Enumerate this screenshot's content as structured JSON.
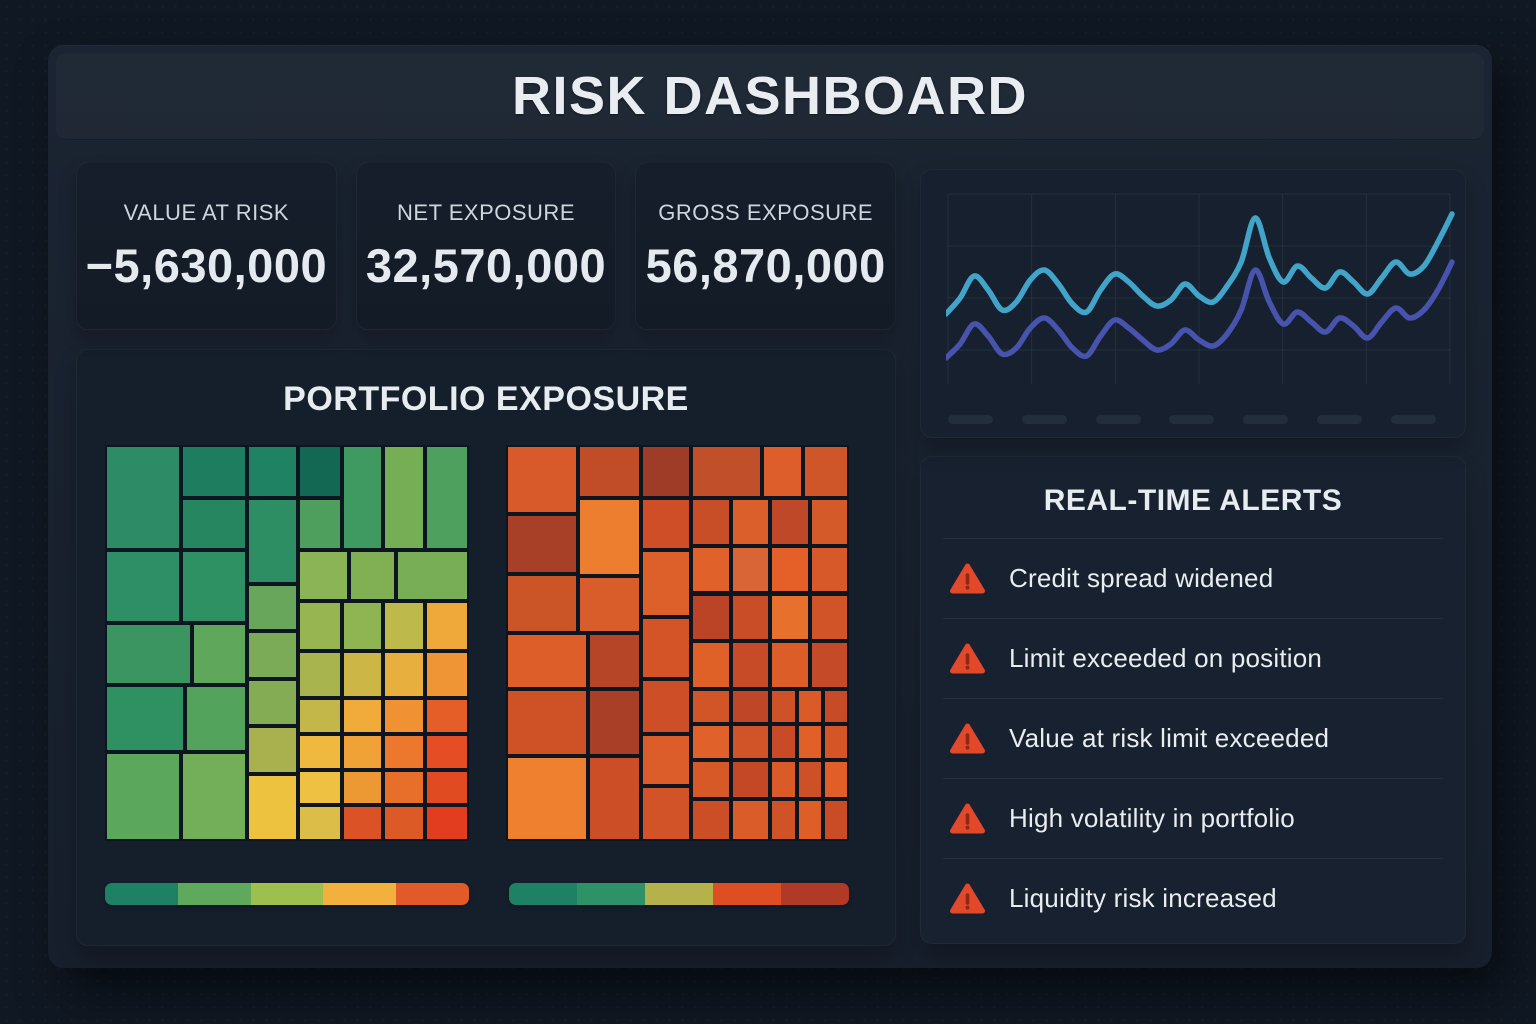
{
  "title": "RISK DASHBOARD",
  "kpis": [
    {
      "label": "VALUE AT RISK",
      "value": "−5,630,000"
    },
    {
      "label": "NET EXPOSURE",
      "value": "32,570,000"
    },
    {
      "label": "GROSS EXPOSURE",
      "value": "56,870,000"
    }
  ],
  "portfolio": {
    "title": "PORTFOLIO EXPOSURE",
    "treemaps": [
      {
        "name": "exposure-treemap-green",
        "tiles": [
          [
            0,
            0,
            21,
            26.5,
            "#2D8C66"
          ],
          [
            21,
            0,
            18,
            13.5,
            "#1E7C5F"
          ],
          [
            39,
            0,
            14,
            13.5,
            "#1F8263"
          ],
          [
            53,
            0,
            12,
            13.5,
            "#136853"
          ],
          [
            65,
            0,
            11.5,
            26.5,
            "#3E9A60"
          ],
          [
            76.5,
            0,
            11.5,
            26.5,
            "#76AE56"
          ],
          [
            88,
            0,
            12,
            26.5,
            "#4EA05F"
          ],
          [
            21,
            13.5,
            18,
            13,
            "#26865F"
          ],
          [
            39,
            13.5,
            14,
            21.5,
            "#2D8D63"
          ],
          [
            53,
            13.5,
            12,
            13,
            "#4E9E5E"
          ],
          [
            0,
            26.5,
            21,
            18.5,
            "#2E8F66"
          ],
          [
            21,
            26.5,
            18,
            18.5,
            "#2E9163"
          ],
          [
            53,
            26.5,
            14,
            13,
            "#8AB455"
          ],
          [
            67,
            26.5,
            13,
            13,
            "#81B054"
          ],
          [
            80,
            26.5,
            20,
            13,
            "#78AE55"
          ],
          [
            39,
            35,
            14,
            12,
            "#68A75B"
          ],
          [
            53,
            39.5,
            12,
            12.5,
            "#97B551"
          ],
          [
            65,
            39.5,
            11.5,
            12.5,
            "#8FB553"
          ],
          [
            76.5,
            39.5,
            11.5,
            12.5,
            "#BDBA4B"
          ],
          [
            88,
            39.5,
            12,
            12.5,
            "#EFA93A"
          ],
          [
            0,
            45,
            24,
            15.5,
            "#3A9560"
          ],
          [
            24,
            45,
            15,
            15.5,
            "#5FA85B"
          ],
          [
            39,
            47,
            14,
            12,
            "#7CAB57"
          ],
          [
            53,
            52,
            12,
            12,
            "#A8B44E"
          ],
          [
            65,
            52,
            11.5,
            12,
            "#CBB646"
          ],
          [
            76.5,
            52,
            11.5,
            12,
            "#E7AF3E"
          ],
          [
            88,
            52,
            12,
            12,
            "#F09536"
          ],
          [
            0,
            60.5,
            22,
            17,
            "#2F9161"
          ],
          [
            22,
            60.5,
            17,
            17,
            "#53A35D"
          ],
          [
            39,
            59,
            14,
            12,
            "#83AC55"
          ],
          [
            53,
            64,
            12,
            9,
            "#C3B74A"
          ],
          [
            65,
            64,
            11.5,
            9,
            "#F0AB3B"
          ],
          [
            76.5,
            64,
            11.5,
            9,
            "#F09234"
          ],
          [
            88,
            64,
            12,
            9,
            "#E55E28"
          ],
          [
            39,
            71,
            14,
            12,
            "#A9B14E"
          ],
          [
            53,
            73,
            12,
            9,
            "#EFB83E"
          ],
          [
            65,
            73,
            11.5,
            9,
            "#F0A237"
          ],
          [
            76.5,
            73,
            11.5,
            9,
            "#EB782C"
          ],
          [
            88,
            73,
            12,
            9,
            "#E54D24"
          ],
          [
            0,
            77.5,
            21,
            22.5,
            "#5BA85C"
          ],
          [
            21,
            77.5,
            18,
            22.5,
            "#72AF58"
          ],
          [
            39,
            83,
            14,
            17,
            "#EDC23F"
          ],
          [
            53,
            82,
            12,
            9,
            "#EEC143"
          ],
          [
            65,
            82,
            11.5,
            9,
            "#ED9933"
          ],
          [
            76.5,
            82,
            11.5,
            9,
            "#E76F2A"
          ],
          [
            88,
            82,
            12,
            9,
            "#E04B22"
          ],
          [
            53,
            91,
            12,
            9,
            "#DCBD47"
          ],
          [
            65,
            91,
            11.5,
            9,
            "#DA5226"
          ],
          [
            76.5,
            91,
            11.5,
            9,
            "#DC5A26"
          ],
          [
            88,
            91,
            12,
            9,
            "#E23D1F"
          ]
        ]
      },
      {
        "name": "exposure-treemap-orange",
        "tiles": [
          [
            0,
            0,
            21,
            17.5,
            "#D85A2A"
          ],
          [
            21,
            0,
            18.5,
            13.5,
            "#C14C28"
          ],
          [
            39.5,
            0,
            14.5,
            13.5,
            "#9E3C28"
          ],
          [
            54,
            0,
            20.5,
            13.5,
            "#C1502A"
          ],
          [
            74.5,
            0,
            12,
            13.5,
            "#DD5E2B"
          ],
          [
            86.5,
            0,
            13.5,
            13.5,
            "#CE5629"
          ],
          [
            0,
            17.5,
            21,
            15,
            "#A84028"
          ],
          [
            21,
            13.5,
            18.5,
            19.5,
            "#EE7E2F"
          ],
          [
            39.5,
            13.5,
            14.5,
            13,
            "#D04E27"
          ],
          [
            54,
            13.5,
            11.5,
            12,
            "#C84E28"
          ],
          [
            65.5,
            13.5,
            11.5,
            12,
            "#DB5F2A"
          ],
          [
            77,
            13.5,
            11.5,
            12,
            "#BE4827"
          ],
          [
            88.5,
            13.5,
            11.5,
            12,
            "#D55A29"
          ],
          [
            0,
            32.5,
            21,
            15,
            "#CC5528"
          ],
          [
            21,
            33,
            18.5,
            14.5,
            "#D85D2A"
          ],
          [
            39.5,
            26.5,
            14.5,
            17,
            "#DD5F29"
          ],
          [
            54,
            25.5,
            11.5,
            12,
            "#E06129"
          ],
          [
            65.5,
            25.5,
            11.5,
            12,
            "#D96536"
          ],
          [
            77,
            25.5,
            11.5,
            12,
            "#E55F28"
          ],
          [
            88.5,
            25.5,
            11.5,
            12,
            "#D75829"
          ],
          [
            54,
            37.5,
            11.5,
            12,
            "#BC4426"
          ],
          [
            65.5,
            37.5,
            11.5,
            12,
            "#C94E27"
          ],
          [
            77,
            37.5,
            11.5,
            12,
            "#E8702D"
          ],
          [
            88.5,
            37.5,
            11.5,
            12,
            "#D05428"
          ],
          [
            0,
            47.5,
            24,
            14,
            "#DE5E2A"
          ],
          [
            24,
            47.5,
            15.5,
            14,
            "#B64527"
          ],
          [
            39.5,
            43.5,
            14.5,
            15.5,
            "#D45428"
          ],
          [
            54,
            49.5,
            11.5,
            12,
            "#E06128"
          ],
          [
            65.5,
            49.5,
            11.5,
            12,
            "#C74B27"
          ],
          [
            77,
            49.5,
            11.5,
            12,
            "#DD5D28"
          ],
          [
            88.5,
            49.5,
            11.5,
            12,
            "#C54A27"
          ],
          [
            0,
            61.5,
            24,
            17,
            "#CF5226"
          ],
          [
            24,
            61.5,
            15.5,
            17,
            "#A93F27"
          ],
          [
            39.5,
            59,
            14.5,
            14,
            "#CE4F27"
          ],
          [
            54,
            61.5,
            11.5,
            9,
            "#D25528"
          ],
          [
            65.5,
            61.5,
            11.5,
            9,
            "#BF4626"
          ],
          [
            77,
            61.5,
            7.7,
            9,
            "#CE5227"
          ],
          [
            84.7,
            61.5,
            7.7,
            9,
            "#DB5B28"
          ],
          [
            92.4,
            61.5,
            7.6,
            9,
            "#C74B26"
          ],
          [
            39.5,
            73,
            14.5,
            13,
            "#DC5D29"
          ],
          [
            54,
            70.5,
            11.5,
            9,
            "#E0622A"
          ],
          [
            65.5,
            70.5,
            11.5,
            9,
            "#D15428"
          ],
          [
            77,
            70.5,
            7.7,
            9,
            "#C84A26"
          ],
          [
            84.7,
            70.5,
            7.7,
            9,
            "#E06028"
          ],
          [
            92.4,
            70.5,
            7.6,
            9,
            "#D55527"
          ],
          [
            0,
            78.5,
            24,
            21.5,
            "#EF8030"
          ],
          [
            24,
            78.5,
            15.5,
            21.5,
            "#CB4E27"
          ],
          [
            39.5,
            86,
            14.5,
            14,
            "#D25327"
          ],
          [
            54,
            79.5,
            11.5,
            10,
            "#D85928"
          ],
          [
            65.5,
            79.5,
            11.5,
            10,
            "#C44826"
          ],
          [
            77,
            79.5,
            7.7,
            10,
            "#DB5B28"
          ],
          [
            84.7,
            79.5,
            7.7,
            10,
            "#CD5027"
          ],
          [
            92.4,
            79.5,
            7.6,
            10,
            "#E25E28"
          ],
          [
            54,
            89.5,
            11.5,
            10.5,
            "#CC4E27"
          ],
          [
            65.5,
            89.5,
            11.5,
            10.5,
            "#D95C29"
          ],
          [
            77,
            89.5,
            7.7,
            10.5,
            "#D05227"
          ],
          [
            84.7,
            89.5,
            7.7,
            10.5,
            "#DE5E28"
          ],
          [
            92.4,
            89.5,
            7.6,
            10.5,
            "#C94C26"
          ]
        ]
      }
    ],
    "legends": [
      {
        "name": "legend-gradient-green",
        "colors": [
          "#1E8163",
          "#5FA95C",
          "#9EBE4E",
          "#F2B03C",
          "#E25A27"
        ]
      },
      {
        "name": "legend-gradient-orange",
        "colors": [
          "#1E8163",
          "#2E9168",
          "#B5B24B",
          "#DD4F23",
          "#B03A26"
        ]
      }
    ]
  },
  "chart_data": {
    "type": "line",
    "title": "",
    "grid": {
      "v_lines": 7,
      "h_lines": 4
    },
    "x_axis_ticks": 7,
    "ylim": [
      0,
      100
    ],
    "series": [
      {
        "name": "primary",
        "color": "#41A4C8",
        "values": [
          42,
          50,
          61,
          54,
          44,
          48,
          59,
          64,
          57,
          47,
          43,
          54,
          62,
          58,
          51,
          46,
          49,
          57,
          51,
          48,
          56,
          68,
          90,
          70,
          58,
          66,
          60,
          55,
          63,
          58,
          52,
          60,
          68,
          62,
          66,
          78,
          92
        ]
      },
      {
        "name": "secondary",
        "color": "#4753AC",
        "values": [
          20,
          27,
          37,
          31,
          22,
          25,
          35,
          40,
          34,
          25,
          21,
          31,
          39,
          35,
          29,
          24,
          27,
          34,
          29,
          26,
          32,
          44,
          64,
          48,
          37,
          43,
          38,
          33,
          40,
          36,
          30,
          38,
          45,
          40,
          44,
          54,
          68
        ]
      }
    ]
  },
  "alerts": {
    "title": "REAL-TIME ALERTS",
    "icon": "warning-triangle-icon",
    "icon_color": "#E2492B",
    "items": [
      "Credit spread widened",
      "Limit exceeded on position",
      "Value at risk limit exceeded",
      "High volatility in portfolio",
      "Liquidity risk increased"
    ]
  }
}
